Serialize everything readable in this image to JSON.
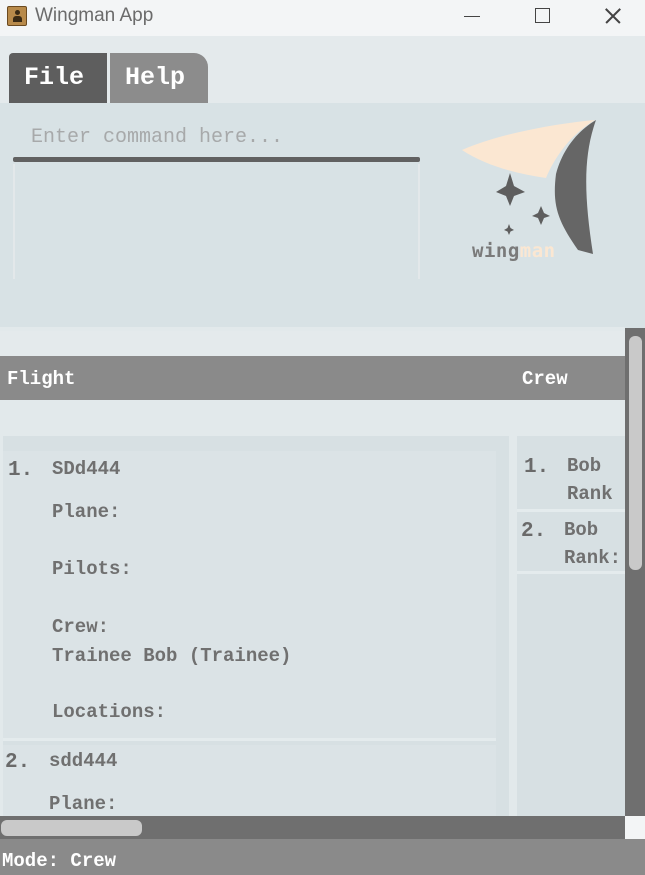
{
  "window": {
    "title": "Wingman App"
  },
  "menu": {
    "file": "File",
    "help": "Help"
  },
  "command": {
    "placeholder": "Enter command here..."
  },
  "logo": {
    "text_main": "wing",
    "text_accent": "man"
  },
  "headers": {
    "flight": "Flight",
    "crew": "Crew"
  },
  "flights": [
    {
      "index": "1.",
      "code": "SDd444",
      "plane_label": "Plane:",
      "pilots_label": "Pilots:",
      "crew_label": "Crew:",
      "crew_value": "Trainee Bob (Trainee)",
      "locations_label": "Locations:"
    },
    {
      "index": "2.",
      "code": "sdd444",
      "plane_label": "Plane:"
    }
  ],
  "crew": [
    {
      "index": "1.",
      "name": "Bob",
      "rank": "Rank"
    },
    {
      "index": "2.",
      "name": "Bob",
      "rank": "Rank:"
    }
  ],
  "status": {
    "mode": "Mode: Crew"
  },
  "colors": {
    "accent": "#fbe7d2",
    "header": "#8a8a8a",
    "panel": "#d8e2e5"
  }
}
